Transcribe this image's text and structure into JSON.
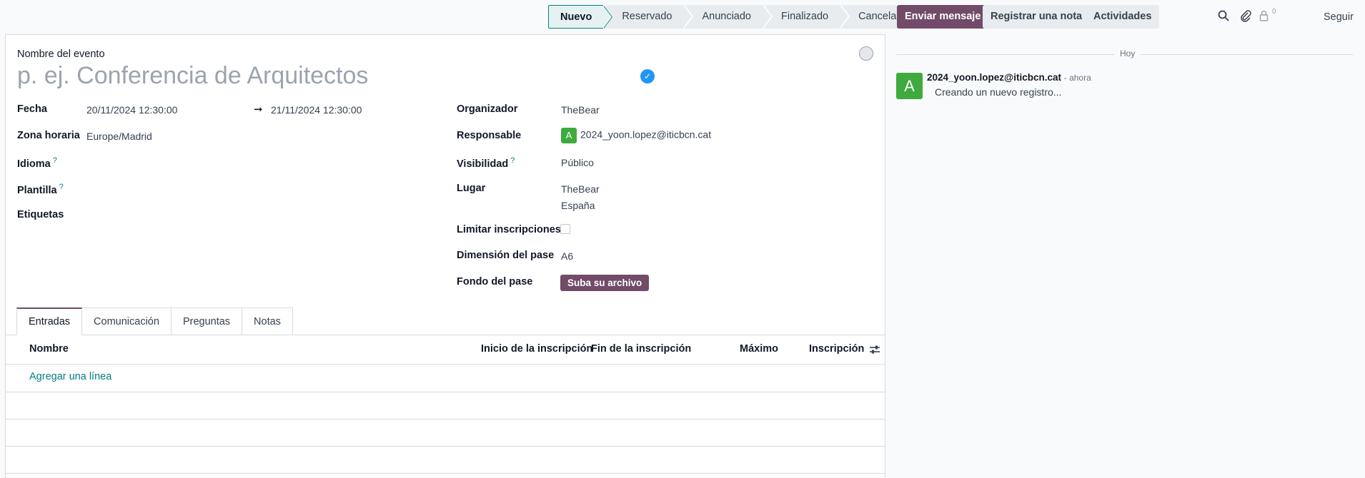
{
  "statusbar": {
    "stages": [
      "Nuevo",
      "Reservado",
      "Anunciado",
      "Finalizado",
      "Cancelado"
    ]
  },
  "form": {
    "title_label": "Nombre del evento",
    "title_placeholder": "p. ej. Conferencia de Arquitectos",
    "fecha_label": "Fecha",
    "fecha_start": "20/11/2024 12:30:00",
    "fecha_arrow": "➞",
    "fecha_end": "21/11/2024 12:30:00",
    "zona_label": "Zona horaria",
    "zona_value": "Europe/Madrid",
    "idioma_label": "Idioma",
    "plantilla_label": "Plantilla",
    "etiquetas_label": "Etiquetas",
    "help_mark": "?",
    "organizador_label": "Organizador",
    "organizador_value": "TheBear",
    "responsable_label": "Responsable",
    "responsable_avatar": "A",
    "responsable_value": "2024_yoon.lopez@iticbcn.cat",
    "visibilidad_label": "Visibilidad",
    "visibilidad_value": "Público",
    "lugar_label": "Lugar",
    "lugar_line1": "TheBear",
    "lugar_line2": "España",
    "limitar_label": "Limitar inscripciones",
    "dimension_label": "Dimensión del pase",
    "dimension_value": "A6",
    "fondo_label": "Fondo del pase",
    "upload_button": "Suba su archivo"
  },
  "tabs": [
    "Entradas",
    "Comunicación",
    "Preguntas",
    "Notas"
  ],
  "table": {
    "columns": [
      "Nombre",
      "Inicio de la inscripción",
      "Fin de la inscripción",
      "Máximo",
      "Inscripción"
    ],
    "add_line": "Agregar una línea"
  },
  "chatter": {
    "send_message": "Enviar mensaje",
    "log_note": "Registrar una nota",
    "activities": "Actividades",
    "follower_count": "0",
    "follow": "Seguir",
    "today": "Hoy",
    "message": {
      "avatar": "A",
      "author": "2024_yoon.lopez@iticbcn.cat",
      "time": "- ahora",
      "body": "Creando un nuevo registro..."
    }
  },
  "colors": {
    "primary": "#714b67",
    "accent": "#017e84",
    "avatar_green": "#3fab3f",
    "check_blue": "#2196f3"
  }
}
